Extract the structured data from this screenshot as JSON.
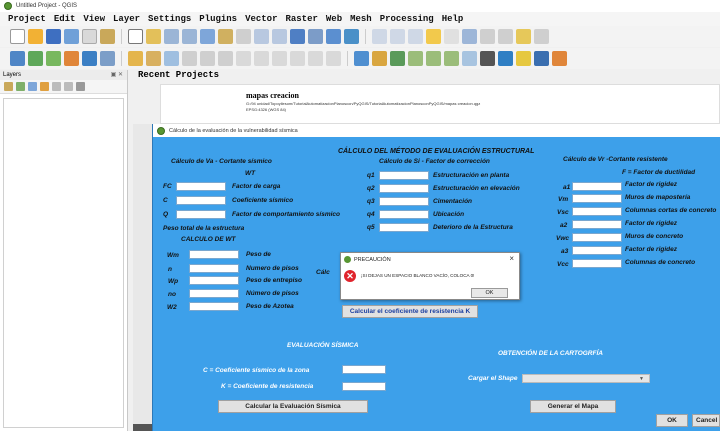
{
  "window": {
    "title": "Untitled Project - QGIS"
  },
  "menu": [
    "Project",
    "Edit",
    "View",
    "Layer",
    "Settings",
    "Plugins",
    "Vector",
    "Raster",
    "Web",
    "Mesh",
    "Processing",
    "Help"
  ],
  "layers_panel": {
    "title": "Layers"
  },
  "recent": {
    "header": "Recent Projects",
    "project_title": "mapas creacion",
    "project_path": "G:/94 unidad/Topoyilesom/TutorialAutomatizacionPlanoscon/PyQGIS/TutorialAutomatizacionPlanosconPyQGIS/mapas creacion.qgz",
    "project_crs": "EPSG:4326 (WGS 84)"
  },
  "dialog": {
    "title": "Cálculo de la evaluación de la vulnerabilidad sísmica",
    "main_title": "CÁLCULO DEL MÉTODO DE EVALUACIÓN ESTRUCTURAL",
    "va": {
      "title": "Cálculo de Va - Cortante sísmico",
      "wt": "WT",
      "fields": [
        {
          "code": "FC",
          "label": "Factor de carga"
        },
        {
          "code": "C",
          "label": "Coeficiente sísmico"
        },
        {
          "code": "Q",
          "label": "Factor de comportamiento sísmico"
        }
      ],
      "peso_total": "Peso total de la estructura",
      "calculo_wt": "CALCULO DE WT",
      "wt_fields": [
        {
          "code": "Wm",
          "label": "Peso de"
        },
        {
          "code": "n",
          "label": "Numero de pisos"
        },
        {
          "code": "Wp",
          "label": "Peso de entrepiso"
        },
        {
          "code": "no",
          "label": "Número de pisos"
        },
        {
          "code": "W2",
          "label": "Peso de Azotea"
        }
      ]
    },
    "si": {
      "title": "Cálculo de Si - Factor de corrección",
      "fields": [
        {
          "code": "q1",
          "label": "Estructuración en planta"
        },
        {
          "code": "q2",
          "label": "Estructuración en elevación"
        },
        {
          "code": "q3",
          "label": "Cimentación"
        },
        {
          "code": "q4",
          "label": "Ubicación"
        },
        {
          "code": "q5",
          "label": "Deterioro de la Estructura"
        }
      ]
    },
    "vr": {
      "title": "Cálculo de Vr -Cortante resistente",
      "f_label": "F = Factor de ductilidad",
      "fields": [
        {
          "code": "a1",
          "label": "Factor de rigidez"
        },
        {
          "code": "Vm",
          "label": "Muros de mapostería"
        },
        {
          "code": "Vsc",
          "label": "Columnas cortas de concreto"
        },
        {
          "code": "a2",
          "label": "Factor de rigidez"
        },
        {
          "code": "Vwc",
          "label": "Muros de concreto"
        },
        {
          "code": "a3",
          "label": "Factor de rigidez"
        },
        {
          "code": "Vcc",
          "label": "Columnas de concreto"
        }
      ]
    },
    "calc_partial": "Cálc",
    "btn_k": "Calcular el coeficiente de resistencia K",
    "eval": {
      "title": "EVALUACIÓN SÍSMICA",
      "c_label": "C = Coeficiente sísmico de la zona",
      "k_label": "K = Coeficiente de resistencia",
      "btn": "Calcular la Evaluación Sísmica"
    },
    "carto": {
      "title": "OBTENCIÓN DE LA CARTOGRFÍA",
      "shape_label": "Cargar el Shape",
      "btn": "Generar el Mapa"
    },
    "ok": "OK",
    "cancel": "Cancel"
  },
  "popup": {
    "title": "PRECAUCIÓN",
    "close": "×",
    "message": "¡SI DEJAS UN ESPACIO BLANCO VACÍO, COLOCA 0!",
    "ok": "OK"
  },
  "colors": {
    "dialog_bg": "#3da0ea",
    "error_red": "#e0242c",
    "qgis_green": "#589632"
  }
}
